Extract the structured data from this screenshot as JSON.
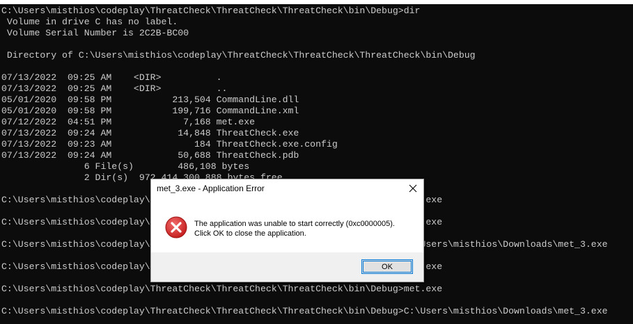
{
  "console": {
    "lines": [
      "C:\\Users\\misthios\\codeplay\\ThreatCheck\\ThreatCheck\\ThreatCheck\\bin\\Debug>dir",
      " Volume in drive C has no label.",
      " Volume Serial Number is 2C2B-BC00",
      "",
      " Directory of C:\\Users\\misthios\\codeplay\\ThreatCheck\\ThreatCheck\\ThreatCheck\\bin\\Debug",
      "",
      "07/13/2022  09:25 AM    <DIR>          .",
      "07/13/2022  09:25 AM    <DIR>          ..",
      "05/01/2020  09:58 PM           213,504 CommandLine.dll",
      "05/01/2020  09:58 PM           199,716 CommandLine.xml",
      "07/12/2022  04:51 PM             7,168 met.exe",
      "07/13/2022  09:24 AM            14,848 ThreatCheck.exe",
      "07/13/2022  09:23 AM               184 ThreatCheck.exe.config",
      "07/13/2022  09:24 AM            50,688 ThreatCheck.pdb",
      "               6 File(s)        486,108 bytes",
      "               2 Dir(s)  972,414,300,888 bytes free",
      "",
      "C:\\Users\\misthios\\codeplay\\ThreatCheck\\ThreatCheck\\ThreatCheck\\bin\\Debug>met.exe",
      "",
      "C:\\Users\\misthios\\codeplay\\ThreatCheck\\ThreatCheck\\ThreatCheck\\bin\\Debug>met.exe",
      "",
      "C:\\Users\\misthios\\codeplay\\ThreatCheck\\ThreatCheck\\ThreatCheck\\bin\\Debug>C:\\Users\\misthios\\Downloads\\met_3.exe",
      "",
      "C:\\Users\\misthios\\codeplay\\ThreatCheck\\ThreatCheck\\ThreatCheck\\bin\\Debug>met.exe",
      "",
      "C:\\Users\\misthios\\codeplay\\ThreatCheck\\ThreatCheck\\ThreatCheck\\bin\\Debug>met.exe",
      "",
      "C:\\Users\\misthios\\codeplay\\ThreatCheck\\ThreatCheck\\ThreatCheck\\bin\\Debug>C:\\Users\\misthios\\Downloads\\met_3.exe"
    ]
  },
  "dialog": {
    "title": "met_3.exe - Application Error",
    "message_line1": "The application was unable to start correctly (0xc0000005).",
    "message_line2": "Click OK to close the application.",
    "ok_label": "OK",
    "close_icon": "close-icon",
    "error_icon": "error-icon",
    "error_color": "#d32f2f"
  }
}
